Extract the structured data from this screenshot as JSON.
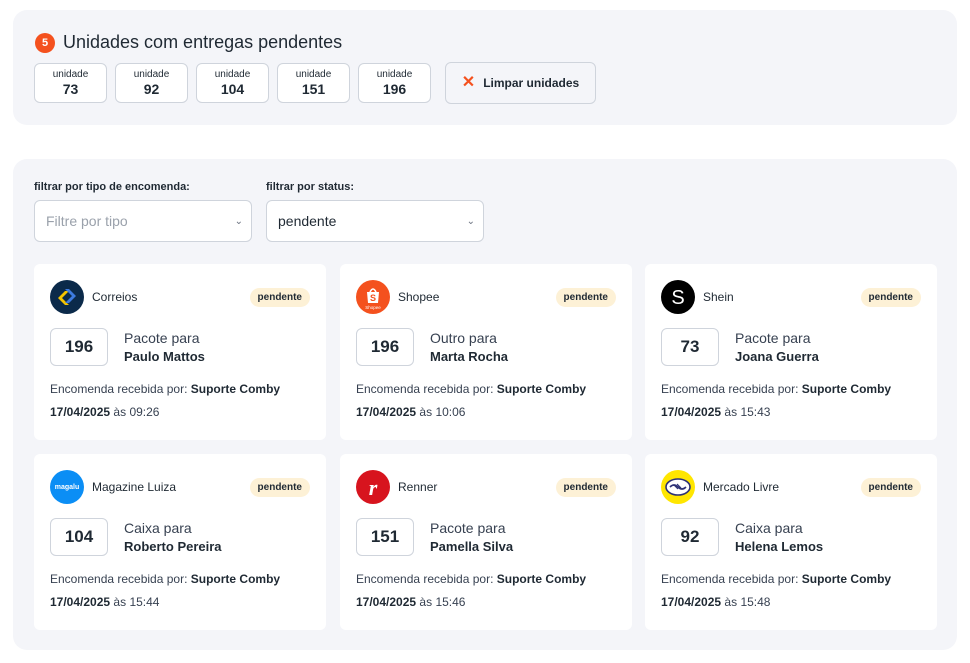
{
  "units": {
    "count": "5",
    "title": "Unidades com entregas pendentes",
    "chip_label": "unidade",
    "items": [
      "73",
      "92",
      "104",
      "151",
      "196"
    ],
    "clear_label": "Limpar unidades"
  },
  "filters": {
    "type_label": "filtrar por tipo de encomenda:",
    "type_placeholder": "Filtre por tipo",
    "status_label": "filtrar por status:",
    "status_value": "pendente"
  },
  "card_text": {
    "received_prefix": "Encomenda recebida por:",
    "time_prefix": "às"
  },
  "cards": [
    {
      "carrier": "Correios",
      "status": "pendente",
      "unit": "196",
      "type": "Pacote para",
      "recipient": "Paulo Mattos",
      "received_by": "Suporte Comby",
      "date": "17/04/2025",
      "time": "09:26"
    },
    {
      "carrier": "Shopee",
      "status": "pendente",
      "unit": "196",
      "type": "Outro para",
      "recipient": "Marta Rocha",
      "received_by": "Suporte Comby",
      "date": "17/04/2025",
      "time": "10:06"
    },
    {
      "carrier": "Shein",
      "status": "pendente",
      "unit": "73",
      "type": "Pacote para",
      "recipient": "Joana Guerra",
      "received_by": "Suporte Comby",
      "date": "17/04/2025",
      "time": "15:43"
    },
    {
      "carrier": "Magazine Luiza",
      "status": "pendente",
      "unit": "104",
      "type": "Caixa para",
      "recipient": "Roberto Pereira",
      "received_by": "Suporte Comby",
      "date": "17/04/2025",
      "time": "15:44"
    },
    {
      "carrier": "Renner",
      "status": "pendente",
      "unit": "151",
      "type": "Pacote para",
      "recipient": "Pamella Silva",
      "received_by": "Suporte Comby",
      "date": "17/04/2025",
      "time": "15:46"
    },
    {
      "carrier": "Mercado Livre",
      "status": "pendente",
      "unit": "92",
      "type": "Caixa para",
      "recipient": "Helena Lemos",
      "received_by": "Suporte Comby",
      "date": "17/04/2025",
      "time": "15:48"
    }
  ],
  "logos": {
    "correios": {
      "icon": "correios-logo",
      "color": "#0b2a4a",
      "accent": "#f5c400"
    },
    "shopee": {
      "icon": "shopee-logo",
      "color": "#f4511e",
      "small_text": "Shopee"
    },
    "shein": {
      "icon": "shein-logo",
      "color": "#000000",
      "letter": "S"
    },
    "magalu": {
      "icon": "magalu-logo",
      "color": "#0b8ef5",
      "text": "magalu"
    },
    "renner": {
      "icon": "renner-logo",
      "color": "#d7141e",
      "letter": "r"
    },
    "mercadolivre": {
      "icon": "mercado-livre-logo",
      "color": "#ffe600"
    }
  }
}
